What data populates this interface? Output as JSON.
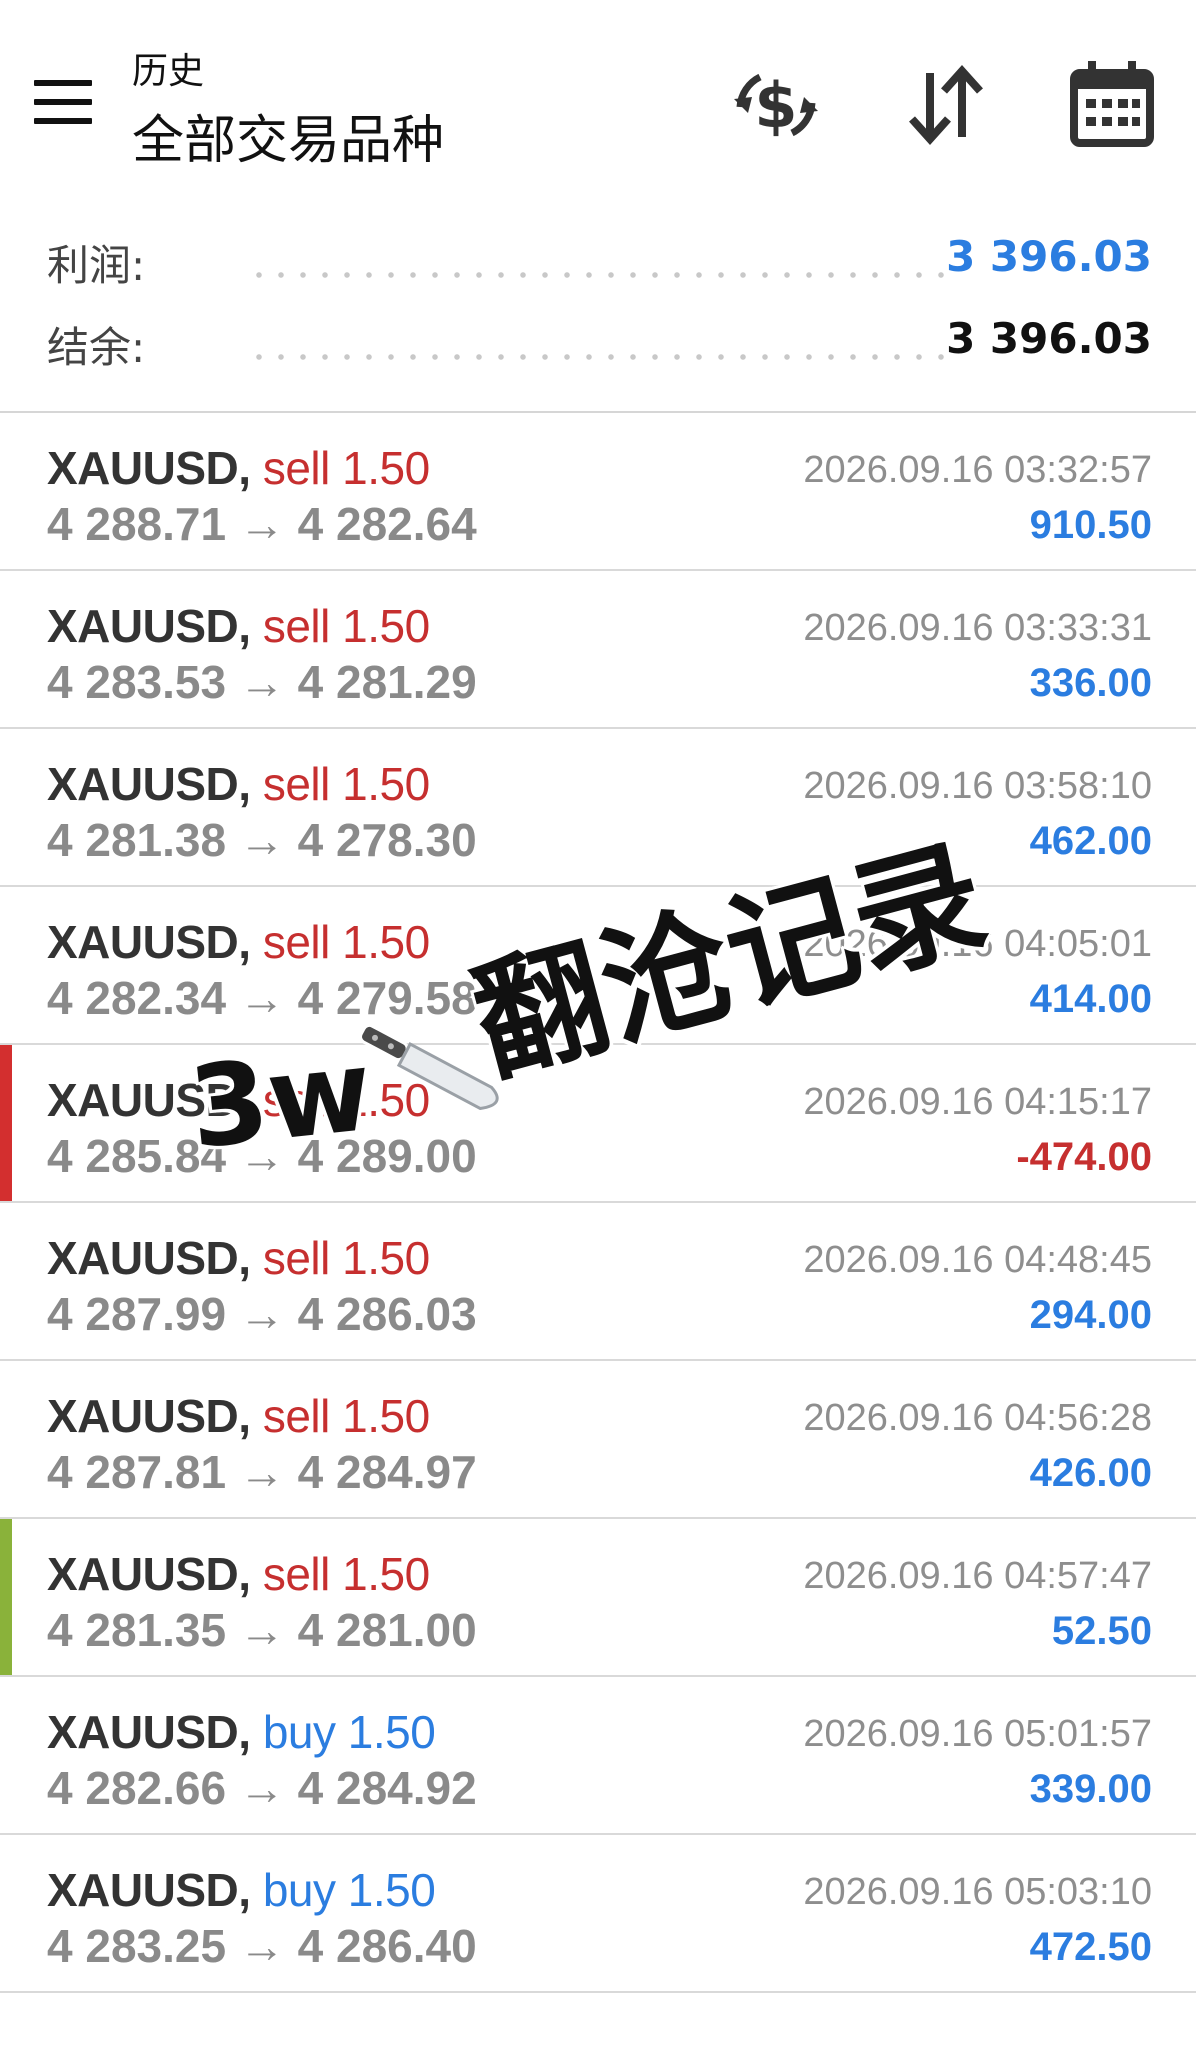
{
  "header": {
    "title_small": "历史",
    "title_big": "全部交易品种",
    "icons": [
      "menu-icon",
      "currency-exchange-icon",
      "sort-icon",
      "calendar-icon"
    ]
  },
  "summary": {
    "profit_label": "利润:",
    "profit_value": "3 396.03",
    "balance_label": "结余:",
    "balance_value": "3 396.03",
    "profit_color": "#2b7de0"
  },
  "overlay": {
    "amount_text": "3w",
    "caption_text": "翻沧记录",
    "icon": "knife-icon"
  },
  "colors": {
    "sell": "#c62f2f",
    "buy": "#2b7de0",
    "positive": "#2b7de0",
    "negative": "#c62f2f",
    "marker_red": "#d32f2f",
    "marker_green": "#8ab23a"
  },
  "trades": [
    {
      "symbol": "XAUUSD,",
      "side": "sell",
      "volume": "1.50",
      "open": "4 288.71",
      "arrow": "→",
      "close": "4 282.64",
      "time": "2026.09.16 03:32:57",
      "profit": "910.50",
      "marker": ""
    },
    {
      "symbol": "XAUUSD,",
      "side": "sell",
      "volume": "1.50",
      "open": "4 283.53",
      "arrow": "→",
      "close": "4 281.29",
      "time": "2026.09.16 03:33:31",
      "profit": "336.00",
      "marker": ""
    },
    {
      "symbol": "XAUUSD,",
      "side": "sell",
      "volume": "1.50",
      "open": "4 281.38",
      "arrow": "→",
      "close": "4 278.30",
      "time": "2026.09.16 03:58:10",
      "profit": "462.00",
      "marker": ""
    },
    {
      "symbol": "XAUUSD,",
      "side": "sell",
      "volume": "1.50",
      "open": "4 282.34",
      "arrow": "→",
      "close": "4 279.58",
      "time": "2026.09.16 04:05:01",
      "profit": "414.00",
      "marker": ""
    },
    {
      "symbol": "XAUUSD,",
      "side": "sell",
      "volume": "1.50",
      "open": "4 285.84",
      "arrow": "→",
      "close": "4 289.00",
      "time": "2026.09.16 04:15:17",
      "profit": "-474.00",
      "marker": "red"
    },
    {
      "symbol": "XAUUSD,",
      "side": "sell",
      "volume": "1.50",
      "open": "4 287.99",
      "arrow": "→",
      "close": "4 286.03",
      "time": "2026.09.16 04:48:45",
      "profit": "294.00",
      "marker": ""
    },
    {
      "symbol": "XAUUSD,",
      "side": "sell",
      "volume": "1.50",
      "open": "4 287.81",
      "arrow": "→",
      "close": "4 284.97",
      "time": "2026.09.16 04:56:28",
      "profit": "426.00",
      "marker": ""
    },
    {
      "symbol": "XAUUSD,",
      "side": "sell",
      "volume": "1.50",
      "open": "4 281.35",
      "arrow": "→",
      "close": "4 281.00",
      "time": "2026.09.16 04:57:47",
      "profit": "52.50",
      "marker": "green"
    },
    {
      "symbol": "XAUUSD,",
      "side": "buy",
      "volume": "1.50",
      "open": "4 282.66",
      "arrow": "→",
      "close": "4 284.92",
      "time": "2026.09.16 05:01:57",
      "profit": "339.00",
      "marker": ""
    },
    {
      "symbol": "XAUUSD,",
      "side": "buy",
      "volume": "1.50",
      "open": "4 283.25",
      "arrow": "→",
      "close": "4 286.40",
      "time": "2026.09.16 05:03:10",
      "profit": "472.50",
      "marker": ""
    }
  ]
}
